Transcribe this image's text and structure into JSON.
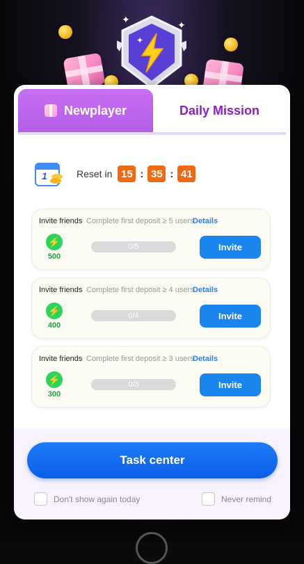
{
  "tabs": {
    "newplayer": "Newplayer",
    "daily": "Daily Mission"
  },
  "reset": {
    "label": "Reset in",
    "hours": "15",
    "minutes": "35",
    "seconds": "41",
    "calendar_day": "1"
  },
  "tasks": [
    {
      "title": "Invite friends",
      "desc": "Complete first deposit ≥ 5 users",
      "details": "Details",
      "reward": "500",
      "progress": "0/5",
      "button": "Invite"
    },
    {
      "title": "Invite friends",
      "desc": "Complete first deposit ≥ 4 users",
      "details": "Details",
      "reward": "400",
      "progress": "0/4",
      "button": "Invite"
    },
    {
      "title": "Invite friends",
      "desc": "Complete first deposit ≥ 3 users",
      "details": "Details",
      "reward": "300",
      "progress": "0/3",
      "button": "Invite"
    }
  ],
  "task_center_label": "Task center",
  "checkboxes": {
    "dont_show": "Don't show again today",
    "never_remind": "Never remind"
  },
  "colors": {
    "accent_purple": "#b35de8",
    "primary_blue": "#1a84ef",
    "timer_orange": "#f06a14",
    "reward_green": "#2bd45a"
  },
  "icons": {
    "badge": "lightning-badge-icon",
    "bolt": "lightning-bolt-icon",
    "calendar": "calendar-coins-icon",
    "gift": "gift-icon"
  }
}
